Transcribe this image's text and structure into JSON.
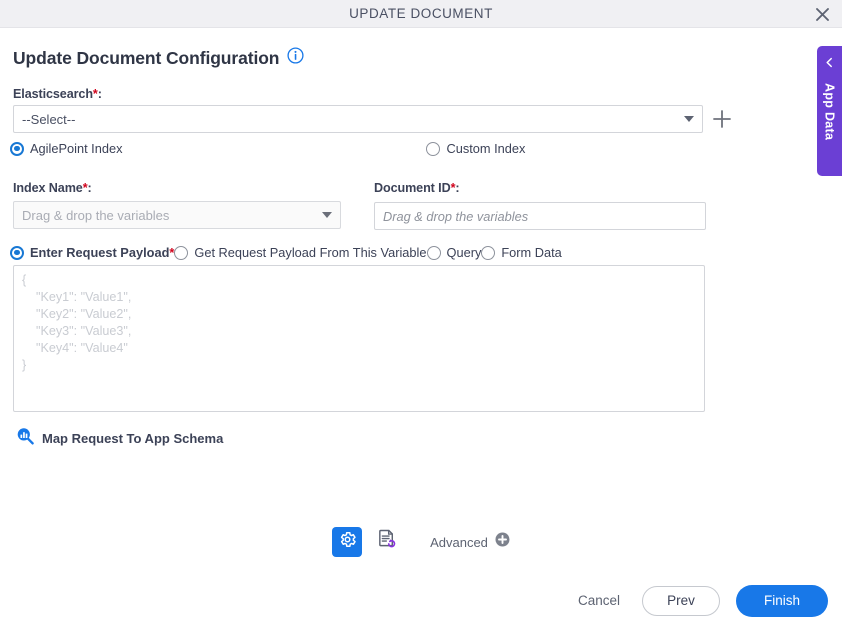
{
  "window": {
    "title": "UPDATE DOCUMENT",
    "close_icon": "close-icon"
  },
  "page": {
    "heading": "Update Document Configuration",
    "info_icon": "info-icon"
  },
  "fields": {
    "elasticsearch": {
      "label": "Elasticsearch",
      "required_mark": "*",
      "label_suffix": ":",
      "selected_value": "--Select--",
      "add_icon": "plus-icon"
    },
    "index_name": {
      "label": "Index Name",
      "required_mark": "*",
      "label_suffix": ":",
      "placeholder": "Drag & drop the variables"
    },
    "document_id": {
      "label": "Document ID",
      "required_mark": "*",
      "label_suffix": ":",
      "placeholder": "Drag & drop the variables",
      "value": ""
    }
  },
  "index_type_options": [
    {
      "label": "AgilePoint Index",
      "selected": true
    },
    {
      "label": "Custom Index",
      "selected": false
    }
  ],
  "payload_type_options": [
    {
      "label": "Enter Request Payload",
      "required_mark": "*",
      "selected": true
    },
    {
      "label": "Get Request Payload From This Variable",
      "required_mark": "",
      "selected": false
    },
    {
      "label": "Query",
      "required_mark": "",
      "selected": false
    },
    {
      "label": "Form Data",
      "required_mark": "",
      "selected": false
    }
  ],
  "payload": {
    "value": "",
    "placeholder": "{\n    \"Key1\": \"Value1\",\n    \"Key2\": \"Value2\",\n    \"Key3\": \"Value3\",\n    \"Key4\": \"Value4\"\n}"
  },
  "map_request": {
    "label": "Map Request To App Schema",
    "icon": "map-schema-search-icon"
  },
  "toolbar": {
    "gear_icon": "gear-icon",
    "doc_refresh_icon": "document-refresh-icon",
    "advanced_label": "Advanced",
    "advanced_add_icon": "plus-circle-icon"
  },
  "footer": {
    "cancel_label": "Cancel",
    "prev_label": "Prev",
    "finish_label": "Finish"
  },
  "app_data_tab": {
    "label": "App Data",
    "chevron_icon": "chevron-left-icon"
  },
  "colors": {
    "accent_blue": "#1878e8",
    "purple": "#6b3fd4",
    "required_red": "#d0021b",
    "titlebar_bg": "#f0f0f3"
  }
}
